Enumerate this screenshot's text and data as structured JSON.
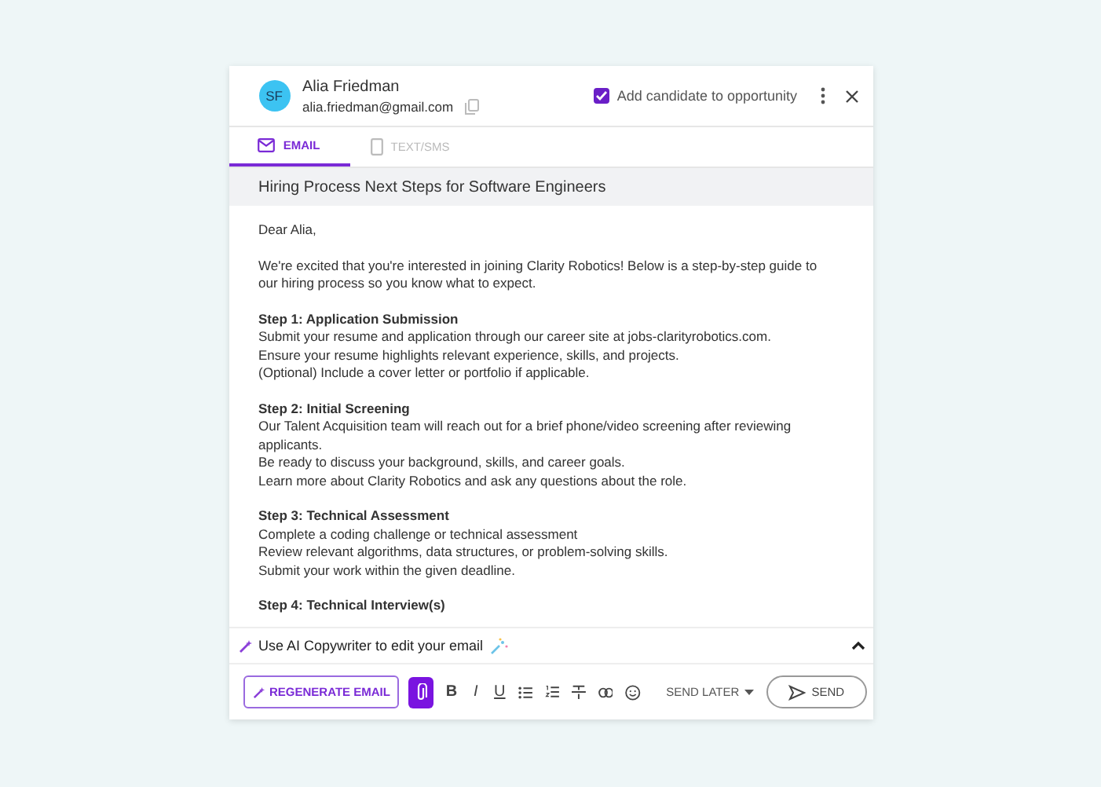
{
  "contact": {
    "initials": "SF",
    "name": "Alia Friedman",
    "email": "alia.friedman@gmail.com"
  },
  "add_candidate": {
    "label": "Add candidate to opportunity",
    "checked": true
  },
  "tabs": [
    {
      "label": "EMAIL",
      "kind": "email",
      "selected": true
    },
    {
      "label": "TEXT/SMS",
      "kind": "sms",
      "selected": false
    }
  ],
  "subject": "Hiring Process Next Steps for Software Engineers",
  "body": [
    {
      "lines": [
        "Dear Alia,"
      ]
    },
    {
      "lines": [
        "We're excited that you're interested in joining Clarity Robotics! Below is a step-by-step guide to our hiring process so you know what to expect."
      ]
    },
    {
      "heading": "Step 1: Application Submission",
      "lines": [
        "Submit your resume and application through our career site at jobs-clarityrobotics.com.",
        "Ensure your resume highlights relevant experience, skills, and projects.",
        "(Optional) Include a cover letter or portfolio if applicable."
      ]
    },
    {
      "heading": "Step 2: Initial Screening",
      "lines": [
        "Our Talent Acquisition team will reach out for a brief phone/video screening after reviewing applicants.",
        "Be ready to discuss your background, skills, and career goals.",
        "Learn more about Clarity Robotics and ask any questions about the role."
      ]
    },
    {
      "heading": "Step 3: Technical Assessment",
      "lines": [
        "Complete a coding challenge or technical assessment",
        "Review relevant algorithms, data structures, or problem-solving skills.",
        "Submit your work within the given deadline."
      ]
    },
    {
      "heading": "Step 4: Technical Interview(s)"
    }
  ],
  "ai_bar": {
    "label": "Use AI Copywriter to edit your email",
    "expanded": true
  },
  "toolbar": {
    "regenerate": "REGENERATE EMAIL",
    "format": [
      {
        "kind": "bold",
        "label": "B"
      },
      {
        "kind": "italic",
        "label": "I"
      },
      {
        "kind": "underline",
        "label": "U"
      }
    ],
    "send_later": "SEND LATER",
    "send": "SEND"
  }
}
